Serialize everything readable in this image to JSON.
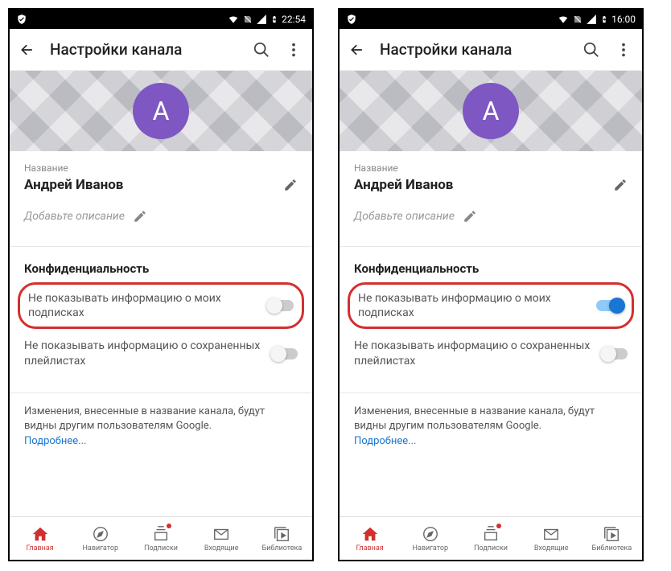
{
  "screens": [
    {
      "time": "22:54",
      "toggle1_on": false
    },
    {
      "time": "16:00",
      "toggle1_on": true
    }
  ],
  "statusbar": {
    "shield": "⬣"
  },
  "toolbar": {
    "title": "Настройки канала"
  },
  "avatar": {
    "letter": "A"
  },
  "profile": {
    "label": "Название",
    "name": "Андрей Иванов",
    "desc_placeholder": "Добавьте описание"
  },
  "privacy": {
    "title": "Конфиденциальность",
    "toggle1": "Не показывать информацию о моих подписках",
    "toggle2": "Не показывать информацию о сохраненных плейлистах"
  },
  "info": {
    "text": "Изменения, внесенные в название канала, будут видны другим пользователям Google.",
    "link": "Подробнее..."
  },
  "nav": {
    "home": "Главная",
    "explore": "Навигатор",
    "subs": "Подписки",
    "inbox": "Входящие",
    "library": "Библиотека"
  }
}
